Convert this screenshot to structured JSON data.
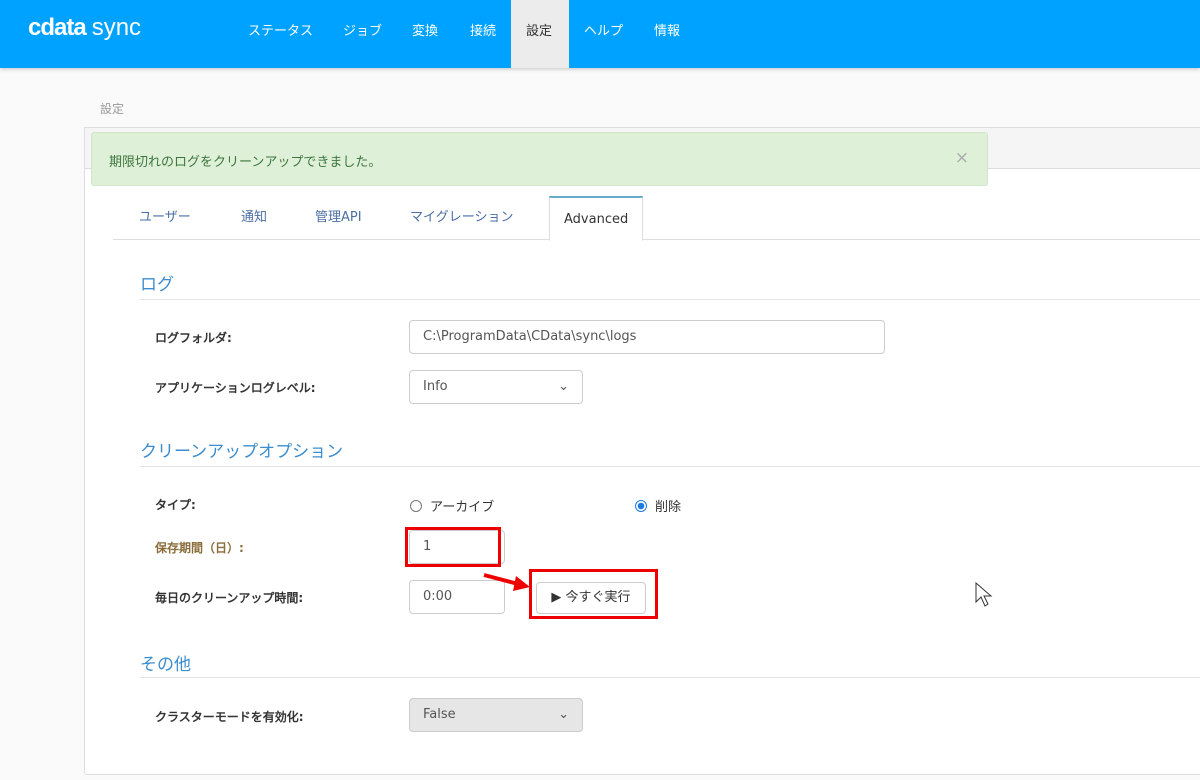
{
  "header": {
    "logo": "cdata sync",
    "logo_main": "cdata",
    "logo_sub": "sync",
    "nav": [
      "ステータス",
      "ジョブ",
      "変換",
      "接続",
      "設定",
      "ヘルプ",
      "情報"
    ],
    "active": "設定"
  },
  "breadcrumb": "設定",
  "alert": {
    "message": "期限切れのログをクリーンアップできました。",
    "close": "×"
  },
  "tabs": [
    "ユーザー",
    "通知",
    "管理API",
    "マイグレーション",
    "Advanced"
  ],
  "log": {
    "title": "ログ",
    "folder_label": "ログフォルダ:",
    "folder_value": "C:\\ProgramData\\CData\\sync\\logs",
    "level_label": "アプリケーションログレベル:",
    "level_value": "Info"
  },
  "cleanup": {
    "title": "クリーンアップオプション",
    "type_label": "タイプ:",
    "option_archive": "アーカイブ",
    "option_delete": "削除",
    "retention_label": "保存期間（日）:",
    "retention_value": "1",
    "time_label": "毎日のクリーンアップ時間:",
    "time_value": "0:00",
    "run_now": "▶ 今すぐ実行"
  },
  "other": {
    "title": "その他",
    "cluster_label": "クラスターモードを有効化:",
    "cluster_value": "False"
  },
  "colors": {
    "nav": "#00a2ff",
    "highlight": "#e00000"
  }
}
